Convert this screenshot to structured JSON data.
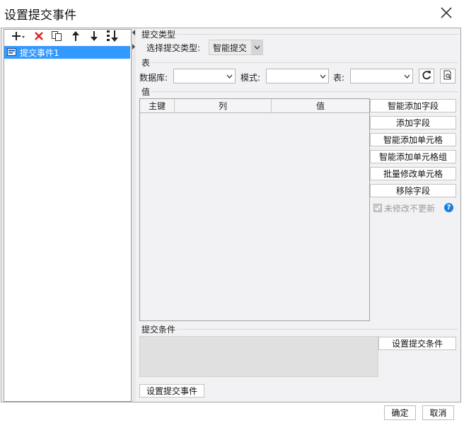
{
  "window": {
    "title": "设置提交事件"
  },
  "left_toolbar": {
    "add_icon": "plus-dropdown-icon",
    "delete_icon": "red-x-icon",
    "copy_icon": "copy-icon",
    "up_icon": "arrow-up-icon",
    "down_icon": "arrow-down-icon",
    "sort_icon": "sort-down-icon"
  },
  "tree": {
    "items": [
      {
        "label": "提交事件1",
        "selected": true
      }
    ]
  },
  "submit_type": {
    "section_title": "提交类型",
    "label": "选择提交类型:",
    "value": "智能提交"
  },
  "table_section": {
    "section_title": "表",
    "db_label": "数据库:",
    "db_value": "",
    "schema_label": "模式:",
    "schema_value": "",
    "table_label": "表:",
    "table_value": ""
  },
  "values": {
    "section_title": "值",
    "columns": [
      "主键",
      "列",
      "值"
    ],
    "rows": []
  },
  "side_buttons": [
    "智能添加字段",
    "添加字段",
    "智能添加单元格",
    "智能添加单元格组",
    "批量修改单元格",
    "移除字段"
  ],
  "no_update_checkbox": {
    "label": "未修改不更新",
    "checked": true,
    "disabled": true
  },
  "conditions": {
    "section_title": "提交条件",
    "set_button": "设置提交条件"
  },
  "set_event_button": "设置提交事件",
  "footer": {
    "ok": "确定",
    "cancel": "取消"
  },
  "colors": {
    "selection": "#3399ff",
    "delete_red": "#e02020",
    "help_blue": "#1a7ee0"
  }
}
